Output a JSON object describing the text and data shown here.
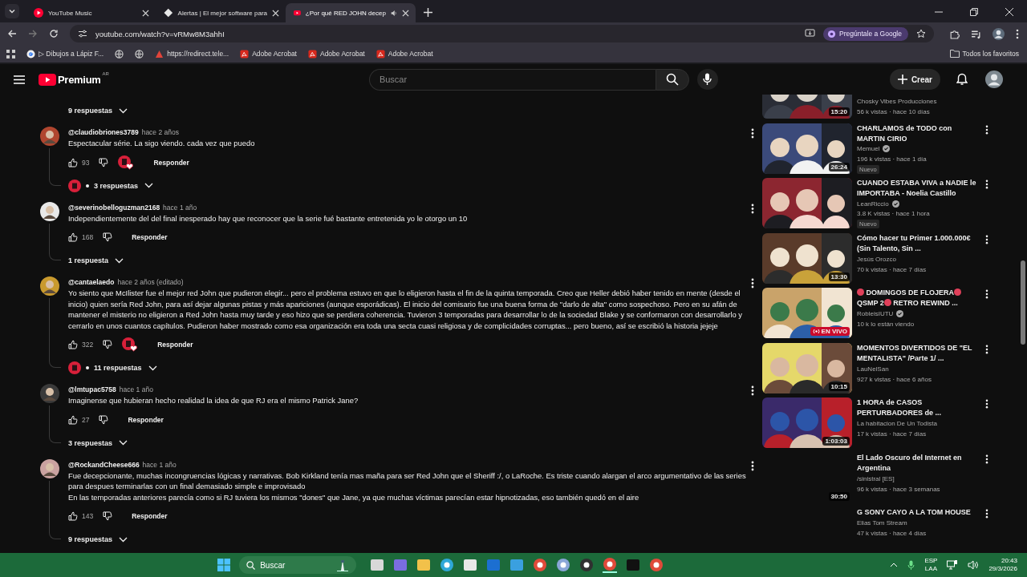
{
  "browser": {
    "tabs": [
      {
        "title": "YouTube Music",
        "selected": false,
        "audio": false
      },
      {
        "title": "Alertas | El mejor software para",
        "selected": false,
        "audio": false
      },
      {
        "title": "¿Por qué RED JOHN decep",
        "selected": true,
        "audio": true
      }
    ],
    "url": "youtube.com/watch?v=vRMw8M3ahhI",
    "ask_google": "Pregúntale a Google",
    "bookmarks": [
      {
        "kind": "google",
        "label": "▷ Dibujos a Lápiz F..."
      },
      {
        "kind": "globe"
      },
      {
        "kind": "globe"
      },
      {
        "kind": "link",
        "label": "https://redirect.tele..."
      },
      {
        "kind": "acrobat",
        "label": "Adobe Acrobat"
      },
      {
        "kind": "acrobat",
        "label": "Adobe Acrobat"
      },
      {
        "kind": "acrobat",
        "label": "Adobe Acrobat"
      }
    ],
    "all_bookmarks": "Todos los favoritos"
  },
  "youtube_header": {
    "logo_text": "Premium",
    "region": "AR",
    "search_placeholder": "Buscar",
    "create": "Crear"
  },
  "comments": {
    "previous_replies": "9 respuestas",
    "items": [
      {
        "author": "@claudiobriones3789",
        "time": "hace 2 años",
        "paragraphs": [
          "Espectacular série. La sigo viendo. cada vez que puedo"
        ],
        "likes": "93",
        "hearted": true,
        "reply_label": "Responder",
        "replies": "3 respuestas",
        "creator_replied": true
      },
      {
        "author": "@severinobelloguzman2168",
        "time": "hace 1 año",
        "paragraphs": [
          "Independientemente del del final inesperado hay que reconocer que la serie fué bastante entretenida yo le otorgo un 10"
        ],
        "likes": "168",
        "hearted": false,
        "reply_label": "Responder",
        "replies": "1 respuesta",
        "creator_replied": false
      },
      {
        "author": "@cantaelaedo",
        "time": "hace 2 años (editado)",
        "paragraphs": [
          "Yo siento que McIlister fue el mejor red John que pudieron elegir... pero el problema estuvo en que lo eligieron hasta el fin de la quinta temporada. Creo que Heller debió haber tenido en mente (desde el inicio) quien sería Red John, para así dejar algunas pistas y más apariciones (aunque esporádicas). El inicio del comisario fue una buena forma de \"darlo de alta\" como sospechoso. Pero en su afán de mantener el misterio no eligieron a Red John hasta muy tarde y eso hizo que se perdiera coherencia. Tuvieron 3 temporadas para desarrollar lo de la sociedad Blake y se conformaron con desarrollarlo y cerrarlo en unos cuantos capítulos. Pudieron haber mostrado como esa organización era toda una secta cuasi religiosa y de complicidades corruptas... pero bueno, así se escribió la historia jejeje"
        ],
        "likes": "322",
        "hearted": true,
        "reply_label": "Responder",
        "replies": "11 respuestas",
        "creator_replied": true
      },
      {
        "author": "@lmtupac5758",
        "time": "hace 1 año",
        "paragraphs": [
          "Imaginense que hubieran hecho realidad la idea de que RJ era el mismo Patrick Jane?"
        ],
        "likes": "27",
        "hearted": false,
        "reply_label": "Responder",
        "replies": "3 respuestas",
        "creator_replied": false
      },
      {
        "author": "@RockandCheese666",
        "time": "hace 1 año",
        "paragraphs": [
          "Fue decepcionante, muchas incongruencias lógicas y narrativas. Bob Kirkland tenía mas maña para ser Red John que el Sheriff :/, o LaRoche. Es triste cuando alargan el arco argumentativo de las series para despues terminarlas con un final demasiado simple e improvisado",
          "En las temporadas anteriores parecía como si RJ tuviera los mismos \"dones\" que Jane, ya que muchas víctimas parecían estar hipnotizadas, eso también quedó en el aire"
        ],
        "likes": "143",
        "hearted": false,
        "reply_label": "Responder",
        "replies": "9 respuestas",
        "creator_replied": false
      }
    ]
  },
  "sidebar": {
    "videos": [
      {
        "kind": "video",
        "channel": "Chosky Vibes Producciones",
        "verified": false,
        "views": "56 k vistas · hace 10 días",
        "duration": "15:20",
        "thumbnail_loaded": true
      },
      {
        "kind": "video",
        "title": "CHARLAMOS de TODO con MARTIN CIRIO",
        "channel": "Memuel",
        "verified": true,
        "views": "196 k vistas · hace 1 día",
        "badge": "Nuevo",
        "duration": "26:24",
        "thumbnail_loaded": true
      },
      {
        "kind": "video",
        "title": "CUANDO ESTABA VIVA a NADIE le IMPORTABA - Noelia Castillo",
        "channel": "LeanRiccio",
        "verified": true,
        "views": "3.8 K vistas · hace 1 hora",
        "badge": "Nuevo",
        "thumbnail_loaded": true
      },
      {
        "kind": "video",
        "title": "Cómo hacer tu Primer 1.000.000€ (Sin Talento, Sin ...",
        "channel": "Jesús Orozco",
        "verified": false,
        "views": "70 k vistas · hace 7 días",
        "duration": "13:30",
        "thumbnail_loaded": true
      },
      {
        "kind": "live",
        "title_parts": [
          "DOMINGOS DE FLOJERA",
          "QSMP 2",
          "RETRO REWIND ..."
        ],
        "channel": "RobleisIUTU",
        "verified": true,
        "views": "10 k lo están viendo",
        "live_label": "EN VIVO",
        "thumbnail_loaded": true
      },
      {
        "kind": "video",
        "title": "MOMENTOS DIVERTIDOS DE \"EL MENTALISTA\" /Parte 1/ ...",
        "channel": "LauNelSan",
        "verified": false,
        "views": "927 k vistas · hace 6 años",
        "duration": "10:15",
        "thumbnail_loaded": true
      },
      {
        "kind": "video",
        "title": "1 HORA de CASOS PERTURBADORES de ...",
        "channel": "La habitacion De Un Todista",
        "verified": false,
        "views": "17 k vistas · hace 7 días",
        "duration": "1:03:03",
        "thumbnail_loaded": true
      },
      {
        "kind": "video",
        "title": "El Lado Oscuro del Internet en Argentina",
        "channel": "/sinistral [ES]",
        "verified": false,
        "views": "96 k vistas · hace 3 semanas",
        "duration": "30:50",
        "thumbnail_loaded": false
      },
      {
        "kind": "video",
        "title": "G SONY CAYO A LA TOM HOUSE",
        "channel": "Elias Tom Stream",
        "verified": false,
        "views": "47 k vistas · hace 4 días",
        "thumbnail_loaded": false
      }
    ]
  },
  "taskbar": {
    "search_placeholder": "Buscar",
    "language": "ESP",
    "layout": "LAA",
    "time": "20:43",
    "date": "29/3/2026"
  }
}
